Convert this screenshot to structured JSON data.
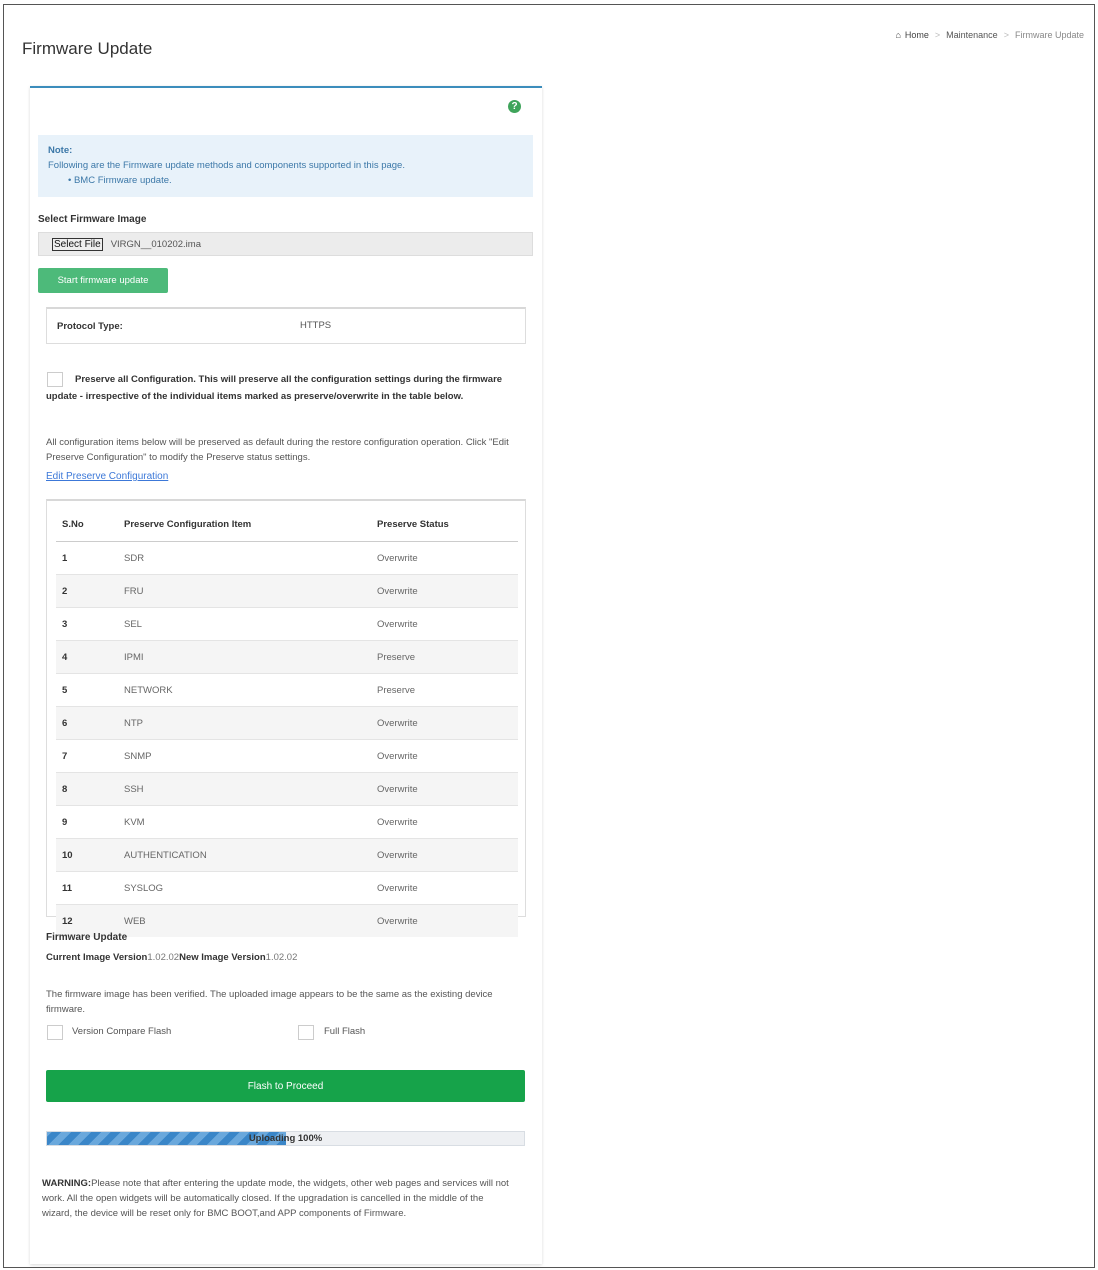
{
  "header": {
    "title": "Firmware Update",
    "breadcrumb": {
      "home": "Home",
      "section": "Maintenance",
      "current": "Firmware Update"
    }
  },
  "note": {
    "title": "Note:",
    "text": "Following are the Firmware update methods and components supported in this page.",
    "bullet": "BMC Firmware update."
  },
  "select_image": {
    "label": "Select Firmware Image",
    "button": "Select File",
    "filename": "VIRGN__010202.ima"
  },
  "start_button": "Start firmware update",
  "protocol": {
    "label": "Protocol Type:",
    "value": "HTTPS"
  },
  "preserve_all": {
    "text": "Preserve all Configuration. This will preserve all the configuration settings during the firmware update - irrespective of the individual items marked as preserve/overwrite in the table below.",
    "checked": false
  },
  "info_text": "All configuration items below will be preserved as default during the restore configuration operation. Click \"Edit Preserve Configuration\" to modify the Preserve status settings.",
  "edit_link": "Edit Preserve Configuration",
  "table": {
    "headers": [
      "S.No",
      "Preserve Configuration Item",
      "Preserve Status"
    ],
    "rows": [
      [
        "1",
        "SDR",
        "Overwrite"
      ],
      [
        "2",
        "FRU",
        "Overwrite"
      ],
      [
        "3",
        "SEL",
        "Overwrite"
      ],
      [
        "4",
        "IPMI",
        "Preserve"
      ],
      [
        "5",
        "NETWORK",
        "Preserve"
      ],
      [
        "6",
        "NTP",
        "Overwrite"
      ],
      [
        "7",
        "SNMP",
        "Overwrite"
      ],
      [
        "8",
        "SSH",
        "Overwrite"
      ],
      [
        "9",
        "KVM",
        "Overwrite"
      ],
      [
        "10",
        "AUTHENTICATION",
        "Overwrite"
      ],
      [
        "11",
        "SYSLOG",
        "Overwrite"
      ],
      [
        "12",
        "WEB",
        "Overwrite"
      ]
    ]
  },
  "firmware_update": {
    "title": "Firmware Update",
    "current_label": "Current Image Version",
    "current_value": "1.02.02",
    "new_label": "New Image Version",
    "new_value": "1.02.02",
    "verified_text": "The firmware image has been verified. The uploaded image appears to be the same as the existing device firmware.",
    "option_version_compare": "Version Compare Flash",
    "option_full_flash": "Full Flash"
  },
  "flash_button": "Flash to Proceed",
  "progress": {
    "label": "Uploading 100%",
    "fill_fraction": 0.5
  },
  "warning": {
    "label": "WARNING:",
    "text": "Please note that after entering the update mode, the widgets, other web pages and services will not work. All the open widgets will be automatically closed. If the upgradation is cancelled in the middle of the wizard, the device will be reset only for BMC BOOT,and APP components of Firmware."
  },
  "colors": {
    "accent": "#3c8dbc",
    "primary_green": "#16a34a",
    "start_green": "#4dba7a",
    "note_bg": "#e8f2fa",
    "link": "#3c78d8"
  }
}
